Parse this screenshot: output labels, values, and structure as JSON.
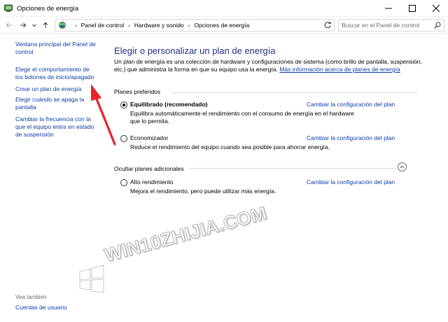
{
  "window": {
    "title": "Opciones de energía",
    "controls": {
      "minimize": "minimize-icon",
      "maximize": "maximize-icon",
      "close": "close-icon"
    }
  },
  "addressbar": {
    "breadcrumbs": [
      "Panel de control",
      "Hardware y sonido",
      "Opciones de energía"
    ],
    "search_placeholder": "Buscar en el Panel de control"
  },
  "sidebar": {
    "items": [
      "Ventana principal del Panel de control",
      "Elegir el comportamiento de los botones de inicio/apagado",
      "Crear un plan de energía",
      "Elegir cuándo se apaga la pantalla",
      "Cambiar la frecuencia con la que el equipo entra en estado de suspensión"
    ],
    "see_also_heading": "Vea también",
    "see_also_items": [
      "Cuentas de usuario"
    ]
  },
  "main": {
    "title": "Elegir o personalizar un plan de energía",
    "description": "Un plan de energía es una colección de hardware y configuraciones de sistema (como brillo de pantalla, suspensión, etc.) que administra la forma en que su equipo usa la energía.",
    "description_link": "Más información acerca de planes de energía",
    "preferred_heading": "Planes preferidos",
    "hidden_heading": "Ocultar planes adicionales",
    "change_label": "Cambiar la configuración del plan",
    "plans": [
      {
        "name": "Equilibrado (recomendado)",
        "selected": true,
        "description": "Equilibra automáticamente el rendimiento con el consumo de energía en el hardware que lo permita."
      },
      {
        "name": "Economizador",
        "selected": false,
        "description": "Reduce el rendimiento del equipo cuando sea posible para ahorrar energía."
      },
      {
        "name": "Alto rendimiento",
        "selected": false,
        "description": "Mejora el rendimiento, pero puede utilizar más energía."
      }
    ]
  },
  "watermark": {
    "text": "WIN10ZHIJIA.COM"
  },
  "colors": {
    "link": "#0f3aa8",
    "title": "#1e3287",
    "arrow": "#e8232a"
  }
}
